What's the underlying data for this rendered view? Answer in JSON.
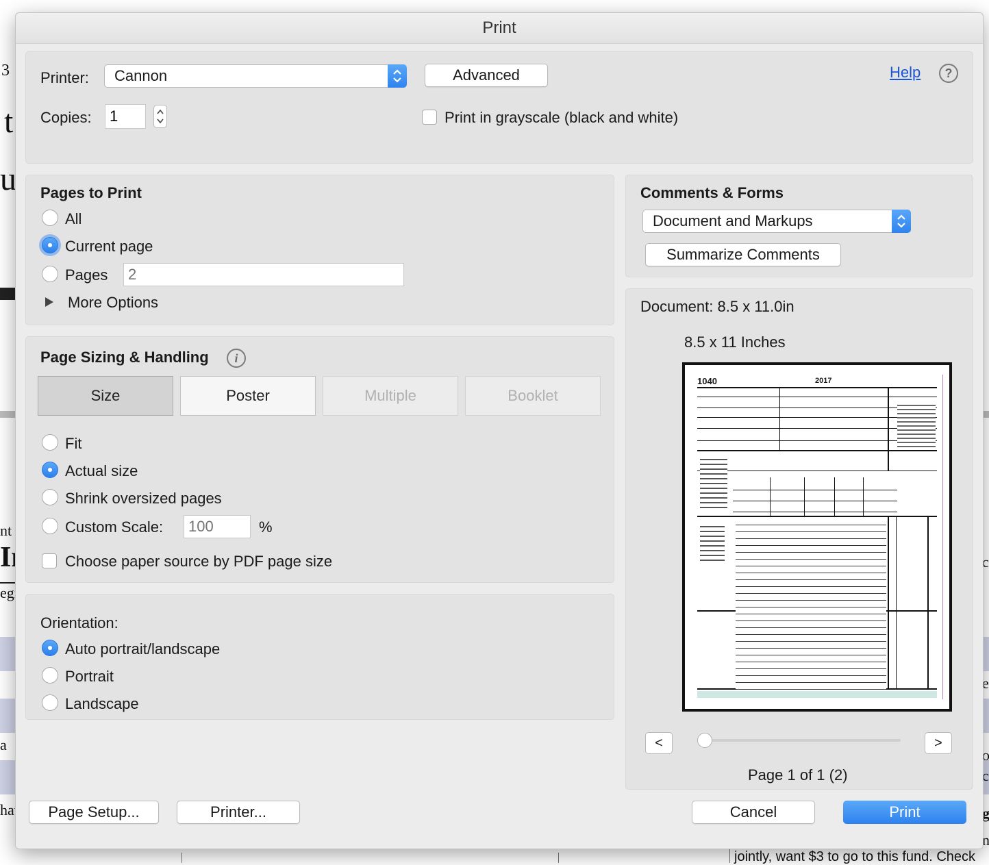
{
  "window": {
    "title": "Print"
  },
  "printer": {
    "label": "Printer:",
    "selected": "Cannon",
    "advanced_label": "Advanced",
    "help_label": "Help"
  },
  "copies": {
    "label": "Copies:",
    "value": "1",
    "grayscale_label": "Print in grayscale (black and white)",
    "grayscale_checked": false
  },
  "pages_to_print": {
    "title": "Pages to Print",
    "options": [
      "All",
      "Current page",
      "Pages"
    ],
    "selected": "Current page",
    "pages_placeholder": "2",
    "more_options_label": "More Options"
  },
  "page_sizing": {
    "title": "Page Sizing & Handling",
    "tabs": [
      "Size",
      "Poster",
      "Multiple",
      "Booklet"
    ],
    "selected_tab": "Size",
    "options": [
      "Fit",
      "Actual size",
      "Shrink oversized pages",
      "Custom Scale:"
    ],
    "selected": "Actual size",
    "custom_scale_placeholder": "100",
    "percent_sign": "%",
    "paper_source_label": "Choose paper source by PDF page size"
  },
  "orientation": {
    "title": "Orientation:",
    "options": [
      "Auto portrait/landscape",
      "Portrait",
      "Landscape"
    ],
    "selected": "Auto portrait/landscape"
  },
  "comments_forms": {
    "title": "Comments & Forms",
    "selected": "Document and Markups",
    "summarize_label": "Summarize Comments"
  },
  "preview": {
    "document_size": "Document: 8.5 x 11.0in",
    "paper_size": "8.5 x 11 Inches",
    "prev_label": "<",
    "next_label": ">",
    "page_indicator": "Page 1 of 1 (2)",
    "form_title": "1040",
    "form_year": "2017"
  },
  "footer": {
    "page_setup_label": "Page Setup...",
    "printer_label": "Printer...",
    "cancel_label": "Cancel",
    "print_label": "Print"
  },
  "background": {
    "fragments": [
      "3",
      "t",
      "u",
      "nt",
      "In",
      "egi",
      "a",
      "hav",
      "c",
      "e",
      "ov",
      "ct",
      "g",
      "nc",
      "jointly, want $3 to go to this fund. Check"
    ]
  },
  "colors": {
    "accent": "#2f83ee",
    "link": "#1a55d6"
  }
}
